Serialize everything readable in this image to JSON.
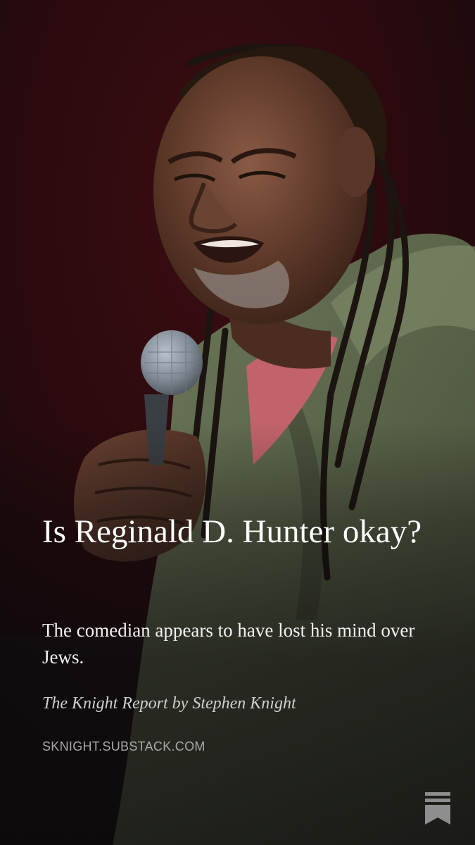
{
  "post": {
    "title": "Is Reginald D. Hunter okay?",
    "subtitle": "The comedian appears to have lost his mind over Jews.",
    "byline": "The Knight Report by Stephen Knight",
    "domain": "SKNIGHT.SUBSTACK.COM"
  },
  "image": {
    "alt": "comedian-with-microphone-photo"
  },
  "icons": {
    "brand": "substack-bookmark-icon"
  },
  "colors": {
    "background": "#1c1214",
    "title_text": "#ffffff",
    "byline_text": "#cfcfcf",
    "domain_text": "#a9a9a9",
    "icon": "#8e8e8e"
  }
}
